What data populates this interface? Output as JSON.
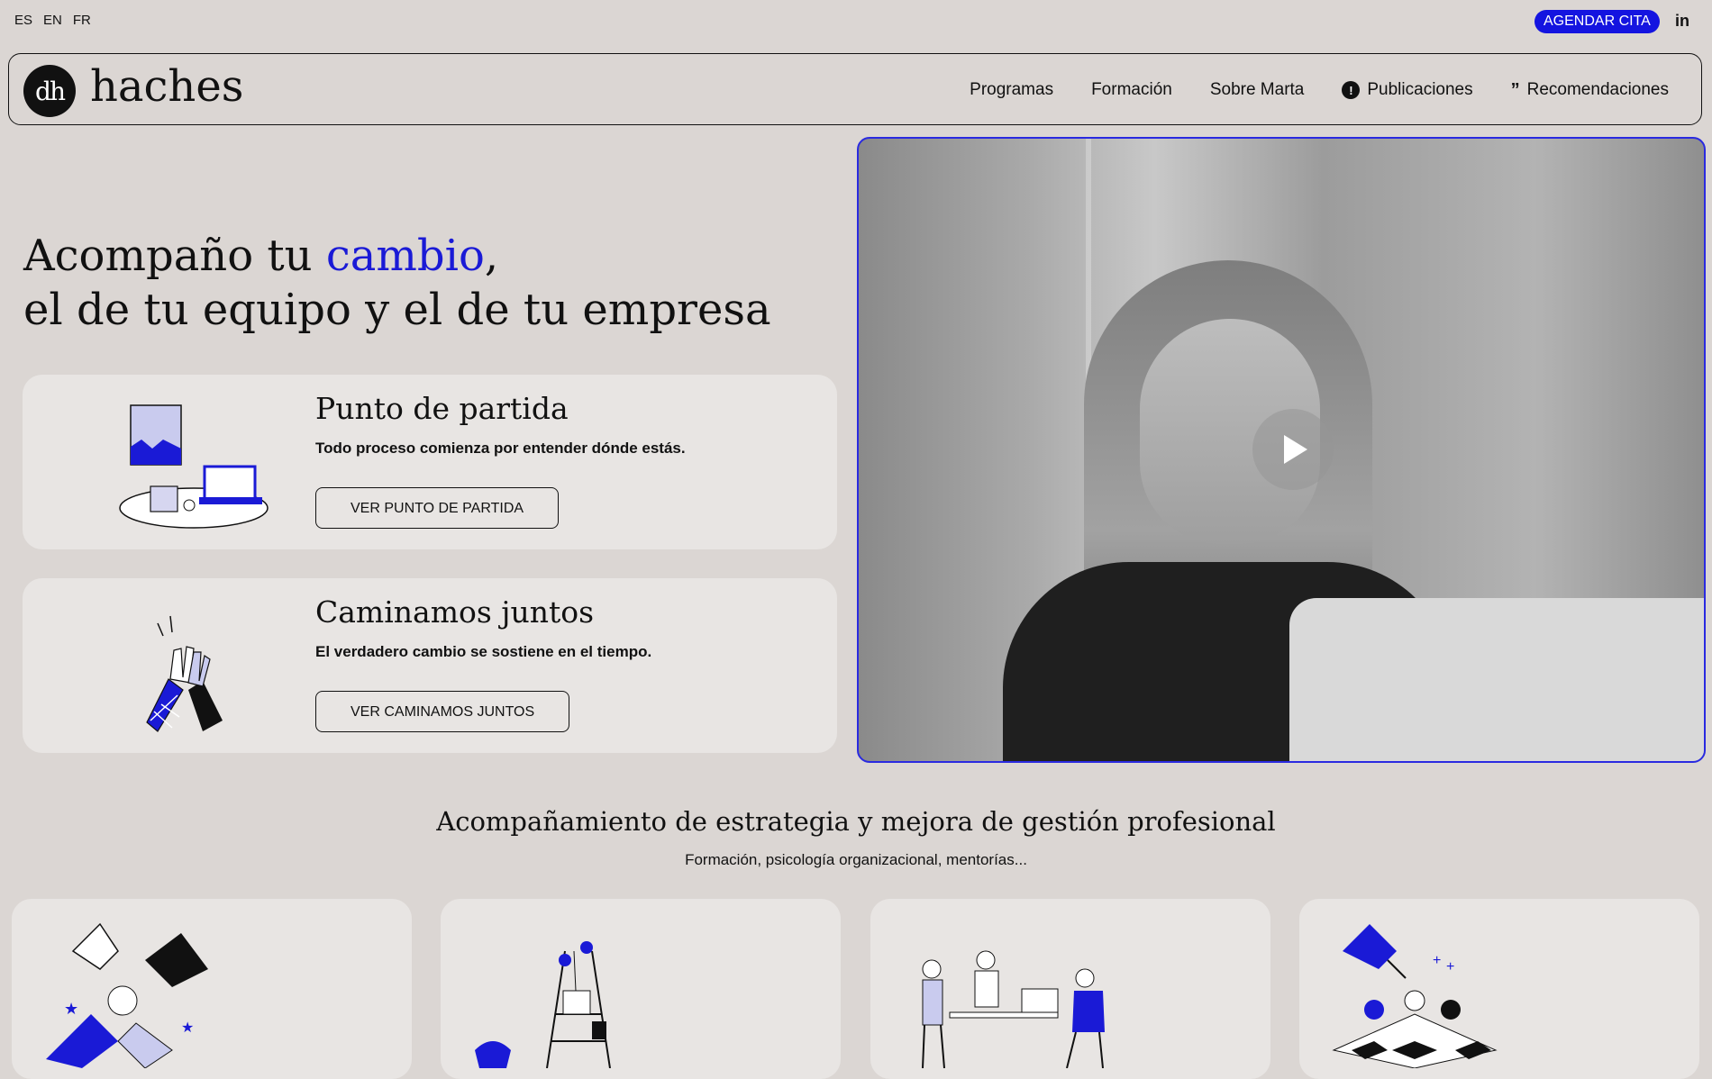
{
  "lang": [
    "ES",
    "EN",
    "FR"
  ],
  "top_cta": "AGENDAR CITA",
  "social": "in",
  "logo": {
    "mark": "dh",
    "name": "haches"
  },
  "nav": [
    {
      "label": "Programas",
      "icon": null
    },
    {
      "label": "Formación",
      "icon": null
    },
    {
      "label": "Sobre Marta",
      "icon": null
    },
    {
      "label": "Publicaciones",
      "icon": "alert-badge-icon"
    },
    {
      "label": "Recomendaciones",
      "icon": "quote-icon"
    }
  ],
  "hero": {
    "line1_pre": "Acompaño tu ",
    "line1_accent": "cambio",
    "line1_post": ",",
    "line2": "el de tu equipo y el de tu empresa"
  },
  "cards": [
    {
      "title": "Punto de partida",
      "desc": "Todo proceso comienza por entender dónde estás.",
      "button": "VER PUNTO DE PARTIDA"
    },
    {
      "title": "Caminamos juntos",
      "desc": "El verdadero cambio se sostiene en el tiempo.",
      "button": "VER CAMINAMOS JUNTOS"
    }
  ],
  "section": {
    "title": "Acompañamiento de estrategia y mejora de gestión profesional",
    "subtitle": "Formación, psicología organizacional, mentorías..."
  },
  "colors": {
    "accent": "#1a1ad6",
    "background": "#dbd6d3",
    "card": "#e8e5e3"
  }
}
